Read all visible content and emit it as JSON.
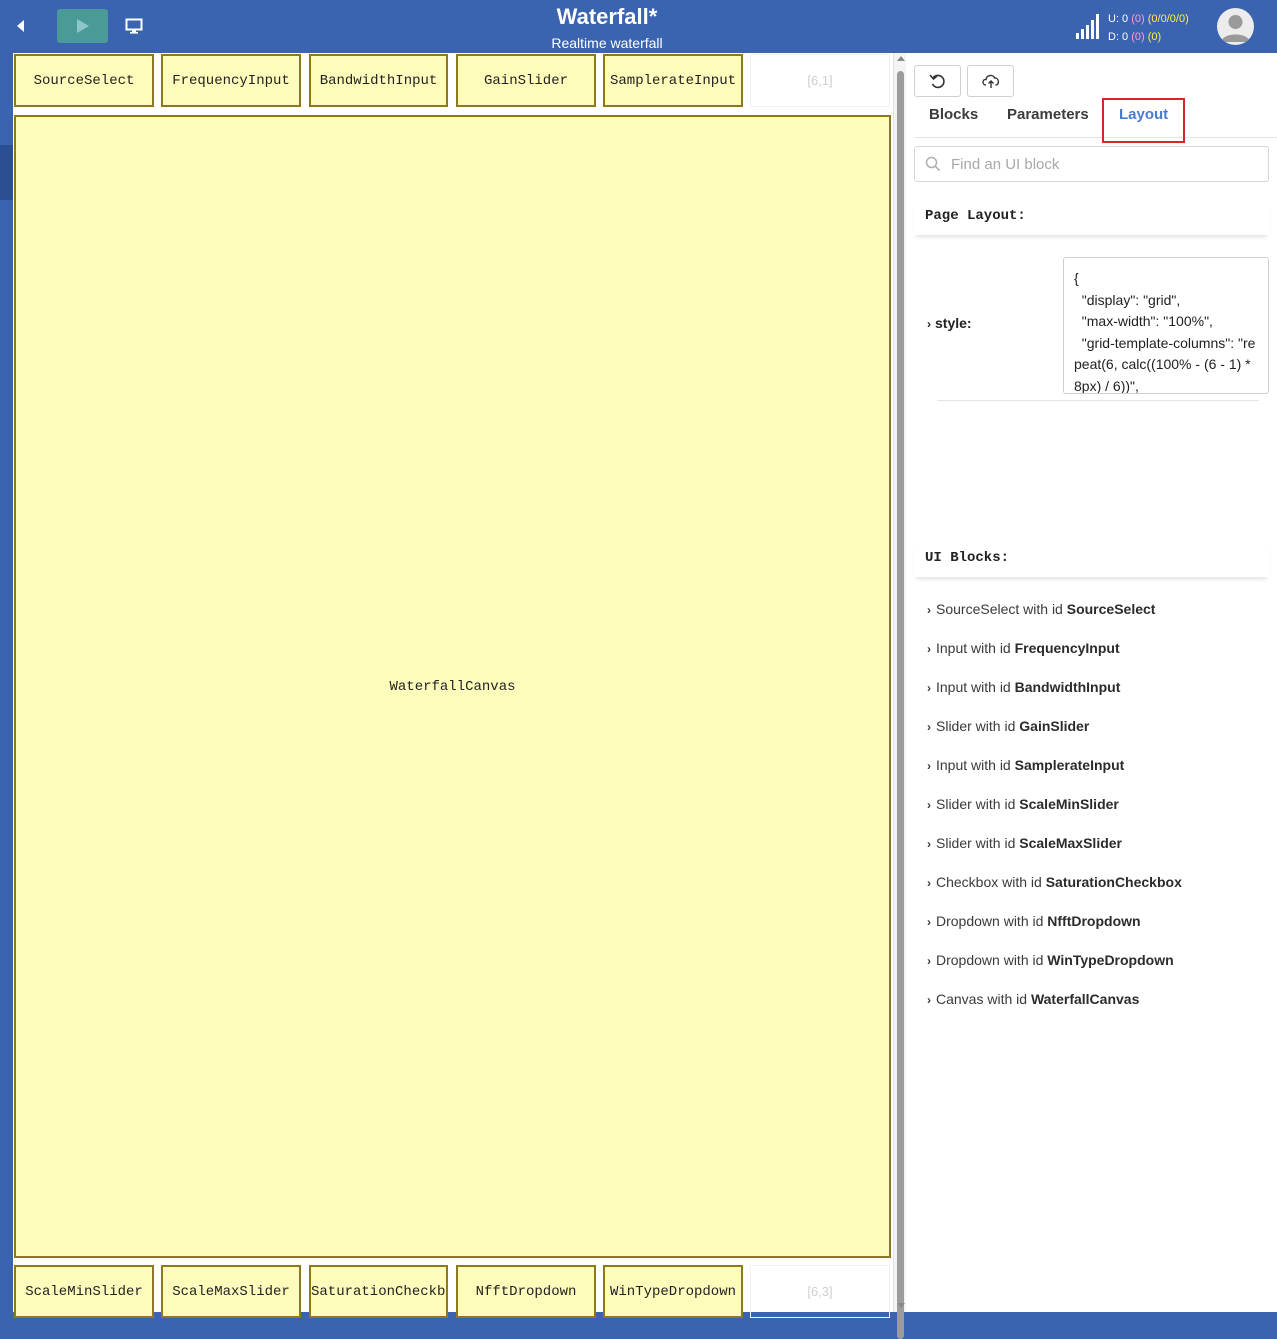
{
  "header": {
    "title": "Waterfall*",
    "subtitle": "Realtime waterfall",
    "stats": {
      "u_label": "U: 0",
      "u_paren": "(0)",
      "u_detail": "(0/0/0/0)",
      "d_label": "D: 0",
      "d_paren": "(0)",
      "d_detail": "(0)"
    },
    "icons": [
      "back-arrow-icon",
      "play-icon",
      "monitor-icon",
      "signal-bars-icon",
      "user-avatar-icon"
    ],
    "colors": {
      "bar": "#3a63b0",
      "play": "#4a9a9a"
    }
  },
  "grid": {
    "top_row": [
      "SourceSelect",
      "FrequencyInput",
      "BandwidthInput",
      "GainSlider",
      "SamplerateInput"
    ],
    "top_empty": "[6,1]",
    "canvas": "WaterfallCanvas",
    "bottom_row": [
      "ScaleMinSlider",
      "ScaleMaxSlider",
      "SaturationCheckb",
      "NfftDropdown",
      "WinTypeDropdown"
    ],
    "bottom_empty": "[6,3]",
    "colors": {
      "block_fill": "#fefcbb",
      "block_border": "#8e7a1a"
    }
  },
  "panel": {
    "toolbar_icons": [
      "undo-icon",
      "cloud-upload-icon"
    ],
    "tabs": [
      "Blocks",
      "Parameters",
      "Layout"
    ],
    "active_tab": "Layout",
    "search_placeholder": "Find an UI block",
    "page_layout_title": "Page Layout:",
    "style_label": "style:",
    "style_value": "{\n  \"display\": \"grid\",\n  \"max-width\": \"100%\",\n  \"grid-template-columns\": \"repeat(6, calc((100% - (6 - 1) * 8px) / 6))\",",
    "ui_blocks_title": "UI Blocks:",
    "ui_blocks": [
      {
        "prefix": "SourceSelect with id ",
        "id": "SourceSelect"
      },
      {
        "prefix": "Input with id ",
        "id": "FrequencyInput"
      },
      {
        "prefix": "Input with id ",
        "id": "BandwidthInput"
      },
      {
        "prefix": "Slider with id ",
        "id": "GainSlider"
      },
      {
        "prefix": "Input with id ",
        "id": "SamplerateInput"
      },
      {
        "prefix": "Slider with id ",
        "id": "ScaleMinSlider"
      },
      {
        "prefix": "Slider with id ",
        "id": "ScaleMaxSlider"
      },
      {
        "prefix": "Checkbox with id ",
        "id": "SaturationCheckbox"
      },
      {
        "prefix": "Dropdown with id ",
        "id": "NfftDropdown"
      },
      {
        "prefix": "Dropdown with id ",
        "id": "WinTypeDropdown"
      },
      {
        "prefix": "Canvas with id ",
        "id": "WaterfallCanvas"
      }
    ],
    "colors": {
      "active_tab": "#4a7bcf",
      "highlight": "#d62727"
    }
  }
}
